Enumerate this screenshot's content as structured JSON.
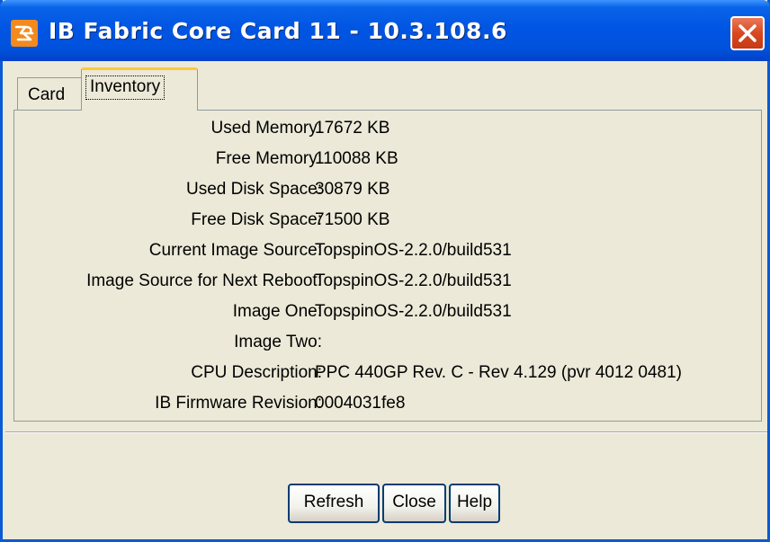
{
  "window": {
    "title": "IB Fabric Core Card 11 - 10.3.108.6",
    "icon": "topspin-logo-icon",
    "close_icon": "close-x-icon"
  },
  "tabs": [
    {
      "label": "Card",
      "selected": false
    },
    {
      "label": "Inventory",
      "selected": true
    }
  ],
  "inventory": [
    {
      "label": "Used Memory:",
      "value": "17672 KB"
    },
    {
      "label": "Free Memory:",
      "value": "110088 KB"
    },
    {
      "label": "Used Disk Space:",
      "value": "30879 KB"
    },
    {
      "label": "Free Disk Space:",
      "value": "71500 KB"
    },
    {
      "label": "Current Image Source:",
      "value": "TopspinOS-2.2.0/build531"
    },
    {
      "label": "Image Source for Next Reboot:",
      "value": "TopspinOS-2.2.0/build531"
    },
    {
      "label": "Image One:",
      "value": "TopspinOS-2.2.0/build531"
    },
    {
      "label": "Image Two:",
      "value": ""
    },
    {
      "label": "CPU Description:",
      "value": "PPC 440GP Rev. C - Rev 4.129 (pvr 4012 0481)"
    },
    {
      "label": "IB Firmware Revision:",
      "value": "0004031fe8"
    }
  ],
  "buttons": {
    "refresh": "Refresh",
    "close": "Close",
    "help": "Help"
  },
  "colors": {
    "titlebar": "#0055e3",
    "window_bg": "#ece9d8",
    "close_button": "#d9471f",
    "selected_tab_accent": "#ffc83c"
  }
}
